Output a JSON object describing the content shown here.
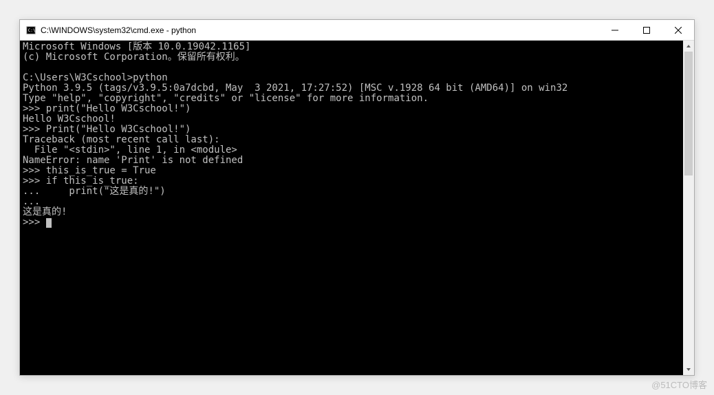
{
  "window": {
    "title": "C:\\WINDOWS\\system32\\cmd.exe - python"
  },
  "terminal": {
    "lines": [
      "Microsoft Windows [版本 10.0.19042.1165]",
      "(c) Microsoft Corporation。保留所有权利。",
      "",
      "C:\\Users\\W3Cschool>python",
      "Python 3.9.5 (tags/v3.9.5:0a7dcbd, May  3 2021, 17:27:52) [MSC v.1928 64 bit (AMD64)] on win32",
      "Type \"help\", \"copyright\", \"credits\" or \"license\" for more information.",
      ">>> print(\"Hello W3Cschool!\")",
      "Hello W3Cschool!",
      ">>> Print(\"Hello W3Cschool!\")",
      "Traceback (most recent call last):",
      "  File \"<stdin>\", line 1, in <module>",
      "NameError: name 'Print' is not defined",
      ">>> this_is_true = True",
      ">>> if this_is_true:",
      "...     print(\"这是真的!\")",
      "...",
      "这是真的!",
      ">>> "
    ]
  },
  "watermark": "@51CTO博客"
}
